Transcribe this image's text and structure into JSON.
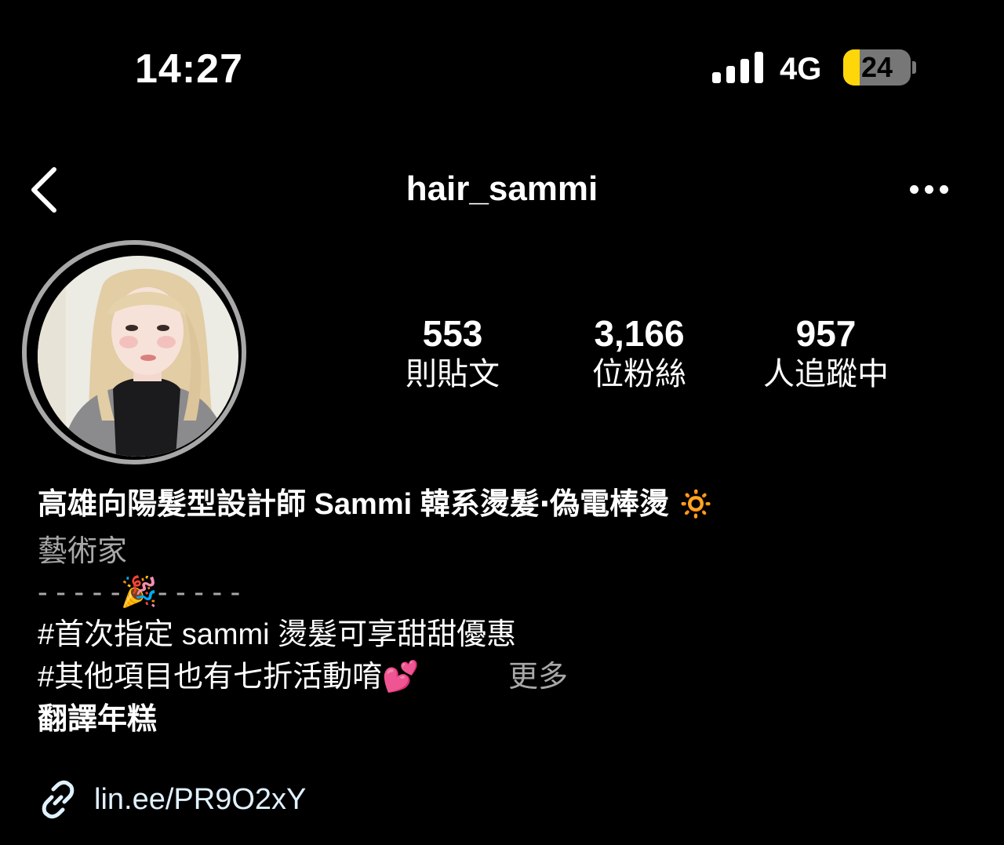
{
  "status_bar": {
    "time": "14:27",
    "network": "4G",
    "battery": "24",
    "battery_level_fraction": 0.24
  },
  "nav": {
    "username": "hair_sammi",
    "back_icon": "chevron-left-icon",
    "more_icon": "ellipsis-icon"
  },
  "stats": [
    {
      "count": "553",
      "label": "則貼文"
    },
    {
      "count": "3,166",
      "label": "位粉絲"
    },
    {
      "count": "957",
      "label": "人追蹤中"
    }
  ],
  "bio": {
    "name": "高雄向陽髮型設計師 Sammi 韓系燙髮‧偽電棒燙 🔅",
    "category": "藝術家",
    "divider": "- - - - -🎉- - - - -",
    "line1": "#首次指定 sammi 燙髮可享甜甜優惠",
    "line2": "#其他項目也有七折活動唷💕",
    "more": "更多",
    "translate": "翻譯年糕",
    "link": "lin.ee/PR9O2xY"
  },
  "colors": {
    "background": "#000000",
    "battery_low": "#ffd60a",
    "secondary_text": "#a8a8a8",
    "link_text": "#e0f1ff"
  }
}
